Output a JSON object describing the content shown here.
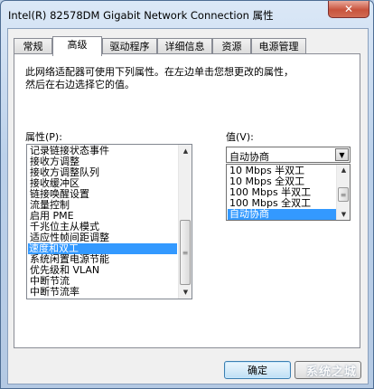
{
  "window": {
    "title": "Intel(R) 82578DM Gigabit Network Connection 属性",
    "close_glyph": "✕"
  },
  "tabs": [
    {
      "label": "常规",
      "active": false
    },
    {
      "label": "高级",
      "active": true
    },
    {
      "label": "驱动程序",
      "active": false
    },
    {
      "label": "详细信息",
      "active": false
    },
    {
      "label": "资源",
      "active": false
    },
    {
      "label": "电源管理",
      "active": false
    }
  ],
  "advanced": {
    "description_line1": "此网络适配器可使用下列属性。在左边单击您想更改的属性，",
    "description_line2": "然后在右边选择它的值。",
    "property_label": "属性(P):",
    "value_label": "值(V):",
    "properties": [
      {
        "label": "记录链接状态事件",
        "selected": false
      },
      {
        "label": "接收方调整",
        "selected": false
      },
      {
        "label": "接收方调整队列",
        "selected": false
      },
      {
        "label": "接收缓冲区",
        "selected": false
      },
      {
        "label": "链接唤醒设置",
        "selected": false
      },
      {
        "label": "流量控制",
        "selected": false
      },
      {
        "label": "启用 PME",
        "selected": false
      },
      {
        "label": "千兆位主从模式",
        "selected": false
      },
      {
        "label": "适应性帧间距调整",
        "selected": false
      },
      {
        "label": "速度和双工",
        "selected": true
      },
      {
        "label": "系统闲置电源节能",
        "selected": false
      },
      {
        "label": "优先级和 VLAN",
        "selected": false
      },
      {
        "label": "中断节流",
        "selected": false
      },
      {
        "label": "中断节流率",
        "selected": false
      }
    ],
    "value_selected": "自动协商",
    "value_options": [
      {
        "label": "10 Mbps 半双工",
        "selected": false
      },
      {
        "label": "10 Mbps 全双工",
        "selected": false
      },
      {
        "label": "100 Mbps 半双工",
        "selected": false
      },
      {
        "label": "100 Mbps 全双工",
        "selected": false
      },
      {
        "label": "自动协商",
        "selected": true
      }
    ]
  },
  "buttons": {
    "ok": "确定",
    "cancel": ""
  },
  "icons": {
    "close": "close-icon",
    "combo_arrow": "chevron-down-icon",
    "scroll_up": "arrow-up-icon",
    "scroll_down": "arrow-down-icon"
  },
  "watermark": "系统之城",
  "colors": {
    "selection": "#3399ff",
    "titlebar": "#bcd1ea",
    "close_button": "#c8533d"
  }
}
